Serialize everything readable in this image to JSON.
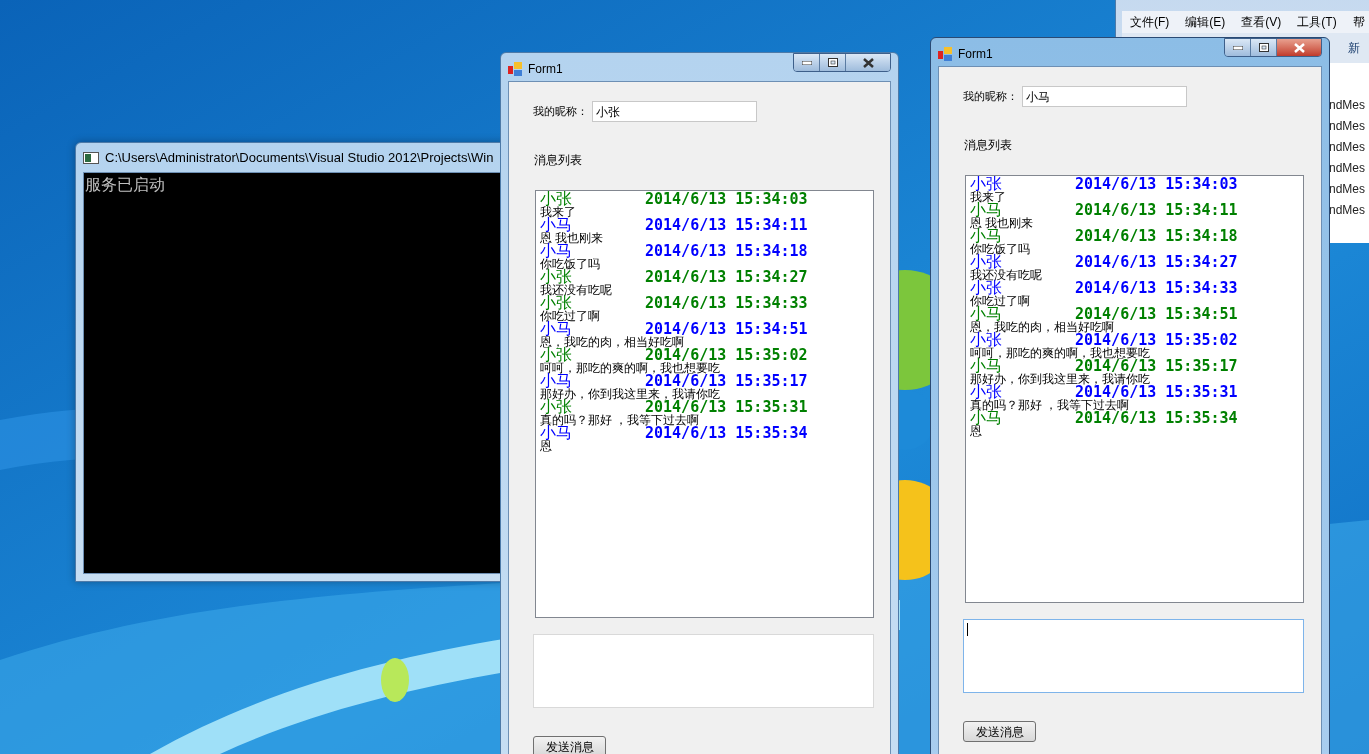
{
  "editor_window": {
    "menu": [
      "文件(F)",
      "编辑(E)",
      "查看(V)",
      "工具(T)",
      "帮"
    ],
    "toolbar_text": "新",
    "code_lines": [
      "ndMes",
      "ndMes",
      "ndMes",
      "ndMes",
      "ndMes",
      "ndMes"
    ]
  },
  "console_window": {
    "title": "C:\\Users\\Administrator\\Documents\\Visual Studio 2012\\Projects\\Win",
    "output": "服务已启动"
  },
  "forms": [
    {
      "title": "Form1",
      "active": false,
      "nickname_label": "我的昵称：",
      "nickname": "小张",
      "list_label": "消息列表",
      "input_focused": false,
      "send_button": "发送消息",
      "messages": [
        {
          "name": "小张",
          "time": "2014/6/13 15:34:03",
          "text": "我来了",
          "color": "#008000"
        },
        {
          "name": "小马",
          "time": "2014/6/13 15:34:11",
          "text": "恩 我也刚来",
          "color": "#0000ff"
        },
        {
          "name": "小马",
          "time": "2014/6/13 15:34:18",
          "text": "你吃饭了吗",
          "color": "#0000ff"
        },
        {
          "name": "小张",
          "time": "2014/6/13 15:34:27",
          "text": "我还没有吃呢",
          "color": "#008000"
        },
        {
          "name": "小张",
          "time": "2014/6/13 15:34:33",
          "text": "你吃过了啊",
          "color": "#008000"
        },
        {
          "name": "小马",
          "time": "2014/6/13 15:34:51",
          "text": "恩，我吃的肉，相当好吃啊",
          "color": "#0000ff"
        },
        {
          "name": "小张",
          "time": "2014/6/13 15:35:02",
          "text": "呵呵，那吃的爽的啊，我也想要吃",
          "color": "#008000"
        },
        {
          "name": "小马",
          "time": "2014/6/13 15:35:17",
          "text": "那好办，你到我这里来，我请你吃",
          "color": "#0000ff"
        },
        {
          "name": "小张",
          "time": "2014/6/13 15:35:31",
          "text": "真的吗？那好 ，我等下过去啊",
          "color": "#008000"
        },
        {
          "name": "小马",
          "time": "2014/6/13 15:35:34",
          "text": "恩",
          "color": "#0000ff"
        }
      ]
    },
    {
      "title": "Form1",
      "active": true,
      "nickname_label": "我的昵称：",
      "nickname": "小马",
      "list_label": "消息列表",
      "input_focused": true,
      "send_button": "发送消息",
      "messages": [
        {
          "name": "小张",
          "time": "2014/6/13 15:34:03",
          "text": "我来了",
          "color": "#0000ff"
        },
        {
          "name": "小马",
          "time": "2014/6/13 15:34:11",
          "text": "恩 我也刚来",
          "color": "#008000"
        },
        {
          "name": "小马",
          "time": "2014/6/13 15:34:18",
          "text": "你吃饭了吗",
          "color": "#008000"
        },
        {
          "name": "小张",
          "time": "2014/6/13 15:34:27",
          "text": "我还没有吃呢",
          "color": "#0000ff"
        },
        {
          "name": "小张",
          "time": "2014/6/13 15:34:33",
          "text": "你吃过了啊",
          "color": "#0000ff"
        },
        {
          "name": "小马",
          "time": "2014/6/13 15:34:51",
          "text": "恩，我吃的肉，相当好吃啊",
          "color": "#008000"
        },
        {
          "name": "小张",
          "time": "2014/6/13 15:35:02",
          "text": "呵呵，那吃的爽的啊，我也想要吃",
          "color": "#0000ff"
        },
        {
          "name": "小马",
          "time": "2014/6/13 15:35:17",
          "text": "那好办，你到我这里来，我请你吃",
          "color": "#008000"
        },
        {
          "name": "小张",
          "time": "2014/6/13 15:35:31",
          "text": "真的吗？那好 ，我等下过去啊",
          "color": "#0000ff"
        },
        {
          "name": "小马",
          "time": "2014/6/13 15:35:34",
          "text": "恩",
          "color": "#008000"
        }
      ]
    }
  ]
}
